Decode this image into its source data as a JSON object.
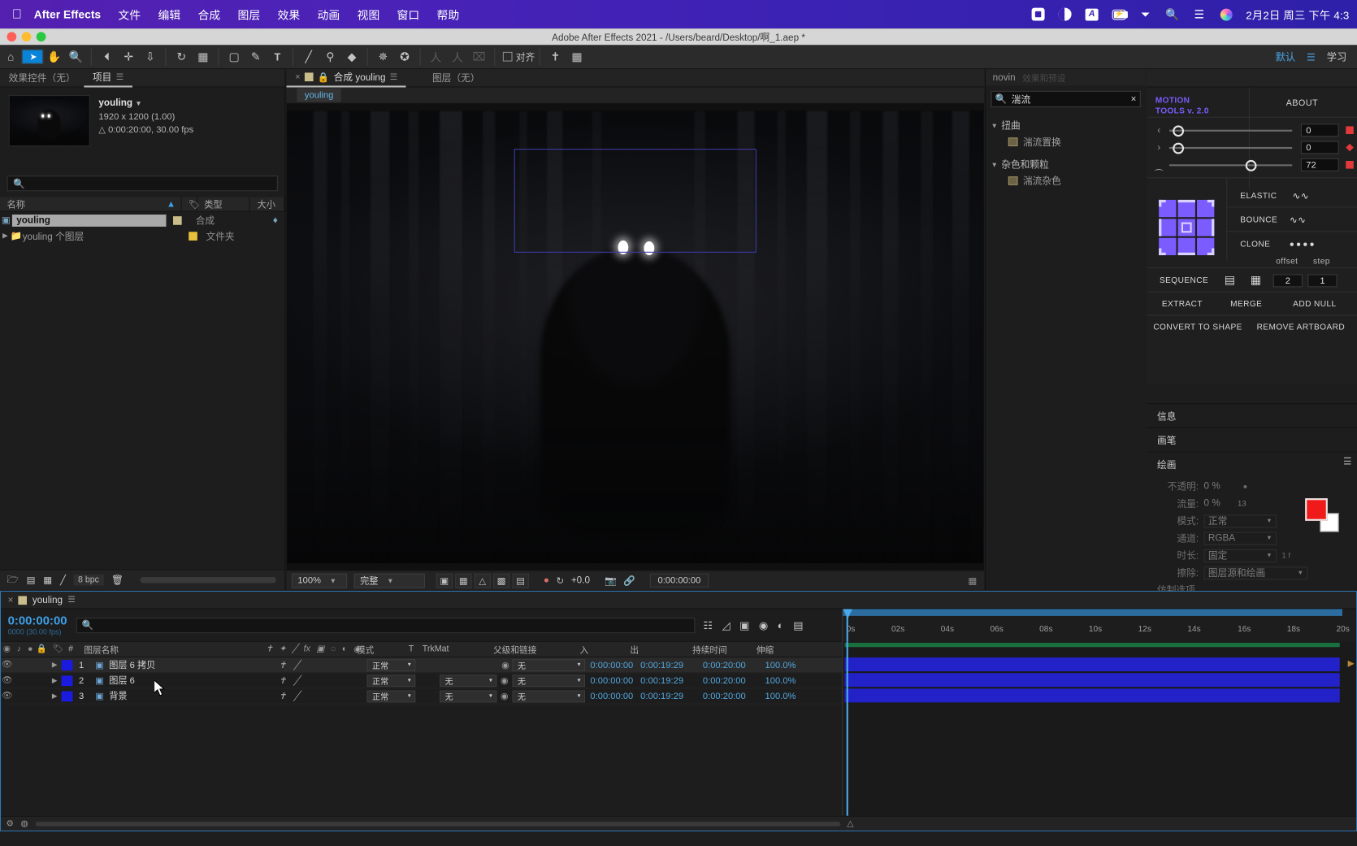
{
  "macmenu": {
    "apple": "apple-logo",
    "app": "After Effects",
    "items": [
      "文件",
      "编辑",
      "合成",
      "图层",
      "效果",
      "动画",
      "视图",
      "窗口",
      "帮助"
    ],
    "status_icons": [
      "record-stop-icon",
      "contrast-icon",
      "input-source-A-icon",
      "battery-charging-icon",
      "wifi-icon",
      "spotlight-search-icon",
      "control-center-icon",
      "siri-icon"
    ],
    "clock": "2月2日 周三 下午 4:3"
  },
  "window": {
    "title": "Adobe After Effects 2021 - /Users/beard/Desktop/啊_1.aep *",
    "traffic": [
      "#ff5f57",
      "#febc2e",
      "#28c840"
    ]
  },
  "toolbar": {
    "tools": [
      {
        "name": "home-icon",
        "glyph": "⌂",
        "selected": false
      },
      {
        "name": "selection-tool",
        "glyph": "➤",
        "selected": true
      },
      {
        "name": "hand-tool",
        "glyph": "✋",
        "selected": false
      },
      {
        "name": "zoom-tool",
        "glyph": "🔍",
        "selected": false
      },
      {
        "name": "rotation-tool",
        "glyph": "◔",
        "selected": false
      },
      {
        "name": "unified-camera-tool",
        "glyph": "✛",
        "selected": false
      },
      {
        "name": "pan-behind-tool",
        "glyph": "⇩",
        "selected": false
      },
      {
        "name": "orbit-tool",
        "glyph": "↺",
        "selected": false
      },
      {
        "name": "region-of-interest",
        "glyph": "⬚",
        "selected": false
      },
      {
        "name": "shape-tool",
        "glyph": "▢",
        "selected": false
      },
      {
        "name": "pen-tool",
        "glyph": "✎",
        "selected": false
      },
      {
        "name": "type-tool",
        "glyph": "T",
        "selected": false
      },
      {
        "name": "brush-tool",
        "glyph": "🖌",
        "selected": false
      },
      {
        "name": "clone-stamp-tool",
        "glyph": "⚲",
        "selected": false
      },
      {
        "name": "eraser-tool",
        "glyph": "◆",
        "selected": false
      },
      {
        "name": "roto-brush-tool",
        "glyph": "✥",
        "selected": false
      },
      {
        "name": "puppet-pin-tool",
        "glyph": "✦",
        "selected": false
      }
    ],
    "dimmed_tools": [
      {
        "name": "puppet-overlap-tool",
        "glyph": "人"
      },
      {
        "name": "puppet-starch-tool",
        "glyph": "人"
      },
      {
        "name": "puppet-advanced-tool",
        "glyph": "⌗"
      }
    ],
    "snapping_label": "对齐",
    "workspace_default": "默认",
    "workspace_learn": "学习"
  },
  "project_panel": {
    "tabs": [
      {
        "label": "效果控件（无）",
        "active": false
      },
      {
        "label": "项目",
        "active": true
      }
    ],
    "item_name": "youling",
    "item_dims": "1920 x 1200 (1.00)",
    "item_duration": "0:00:20:00, 30.00 fps",
    "search_placeholder": "",
    "columns": [
      "名称",
      "类型",
      "大小"
    ],
    "rows": [
      {
        "name": "youling",
        "type": "合成",
        "size": "",
        "selected": true,
        "swatch": "#c9bd8b",
        "icon": "composition-icon"
      },
      {
        "name": "youling 个图层",
        "type": "文件夹",
        "size": "",
        "selected": false,
        "swatch": "#e6c23c",
        "icon": "folder-icon"
      }
    ],
    "footer": {
      "bit_depth": "8 bpc",
      "buttons": [
        "new-folder-icon",
        "new-composition-icon",
        "project-settings-icon",
        "interpret-footage-icon",
        "delete-icon"
      ]
    }
  },
  "comp_panel": {
    "tabs": [
      {
        "label": "合成 youling",
        "active": true
      },
      {
        "label": "图层（无）",
        "active": false
      }
    ],
    "breadcrumb": "youling",
    "footer": {
      "zoom": "100%",
      "resolution": "完整",
      "exposure": "+0.0",
      "timecode": "0:00:00:00",
      "buttons": [
        "toggle-mask-icon",
        "toggle-transparency-grid-icon",
        "toggle-guides-icon",
        "toggle-region-icon",
        "toggle-3d-view-icon",
        "channel-icon",
        "reset-exposure-icon",
        "snapshot-icon",
        "show-snapshot-icon"
      ]
    }
  },
  "effects_panel": {
    "tab_label": "效果和预设",
    "tab_partial": "novin",
    "search_value": "湍流",
    "groups": [
      {
        "label": "扭曲",
        "items": [
          "湍流置换"
        ]
      },
      {
        "label": "杂色和颗粒",
        "items": [
          "湍流杂色"
        ]
      }
    ]
  },
  "motion_tools": {
    "title_line1": "MOTION",
    "title_line2": "TOOLS v. 2.0",
    "about": "ABOUT",
    "sliders": [
      {
        "icon": "chevron-left-icon",
        "value": "0",
        "knob_pct": 3
      },
      {
        "icon": "chevron-right-icon",
        "value": "0",
        "knob_pct": 3
      },
      {
        "icon": "collapse-icon",
        "value": "72",
        "knob_pct": 62
      }
    ],
    "anchor_grid_label": "anchor-point-grid",
    "buttons_right": [
      {
        "label": "ELASTIC",
        "icon": "wave-icon"
      },
      {
        "label": "BOUNCE",
        "icon": "wave-icon"
      },
      {
        "label": "CLONE",
        "icon": "dots-icon"
      }
    ],
    "offset_label": "offset",
    "step_label": "step",
    "sequence_label": "SEQUENCE",
    "sequence_values": [
      "2",
      "1"
    ],
    "row_buttons": [
      "EXTRACT",
      "MERGE",
      "ADD NULL"
    ],
    "row_buttons2": [
      "CONVERT TO SHAPE",
      "REMOVE ARTBOARD"
    ]
  },
  "side_panels": {
    "info": "信息",
    "brushes": "画笔",
    "paint": "绘画",
    "paint_fields": [
      {
        "label": "不透明:",
        "value": "0 %"
      },
      {
        "label": "流量:",
        "value": "0 %"
      },
      {
        "label": "模式:",
        "value": "正常"
      },
      {
        "label": "通道:",
        "value": "RGBA"
      },
      {
        "label": "时长:",
        "value": "固定"
      },
      {
        "label": "擦除:",
        "value": "图层源和绘画"
      }
    ],
    "paint_extra": "仿制选项",
    "brush_diameter": "13",
    "frame_note": "1 f",
    "fg_color": "#f01a1a",
    "bg_color": "#ffffff"
  },
  "timeline": {
    "tab_label": "youling",
    "current_time": "0:00:00:00",
    "current_time_sub": "0000 (30.00 fps)",
    "search_placeholder": "",
    "switch_icons": [
      "composition-mini-flowchart-icon",
      "draft-3d-icon",
      "hide-shy-layers-icon",
      "enable-frame-blending-icon",
      "enable-motion-blur-icon",
      "graph-editor-icon"
    ],
    "columns": [
      "#",
      "图层名称",
      "模式",
      "T",
      "TrkMat",
      "父级和链接",
      "入",
      "出",
      "持续时间",
      "伸缩"
    ],
    "toggle_icons": [
      "eye-icon",
      "audio-icon",
      "solo-icon",
      "lock-icon",
      "label-icon"
    ],
    "switch_header_icons": [
      "shy-icon",
      "collapse-icon",
      "quality-icon",
      "fx-icon",
      "frame-blend-icon",
      "motion-blur-icon",
      "adjustment-icon",
      "3d-icon"
    ],
    "layers": [
      {
        "index": "1",
        "name": "图层 6 拷贝",
        "mode": "正常",
        "trkmat": "",
        "parent": "无",
        "in": "0:00:00:00",
        "out": "0:00:19:29",
        "duration": "0:00:20:00",
        "stretch": "100.0%",
        "color": "#1b1be0",
        "selected": true
      },
      {
        "index": "2",
        "name": "图层 6",
        "mode": "正常",
        "trkmat": "无",
        "parent": "无",
        "in": "0:00:00:00",
        "out": "0:00:19:29",
        "duration": "0:00:20:00",
        "stretch": "100.0%",
        "color": "#1b1be0",
        "selected": false
      },
      {
        "index": "3",
        "name": "背景",
        "mode": "正常",
        "trkmat": "无",
        "parent": "无",
        "in": "0:00:00:00",
        "out": "0:00:19:29",
        "duration": "0:00:20:00",
        "stretch": "100.0%",
        "color": "#1b1be0",
        "selected": false
      }
    ],
    "ruler_ticks": [
      "02s",
      "04s",
      "06s",
      "08s",
      "10s",
      "12s",
      "14s",
      "16s",
      "18s",
      "20s"
    ],
    "ruler_start": "0s"
  }
}
